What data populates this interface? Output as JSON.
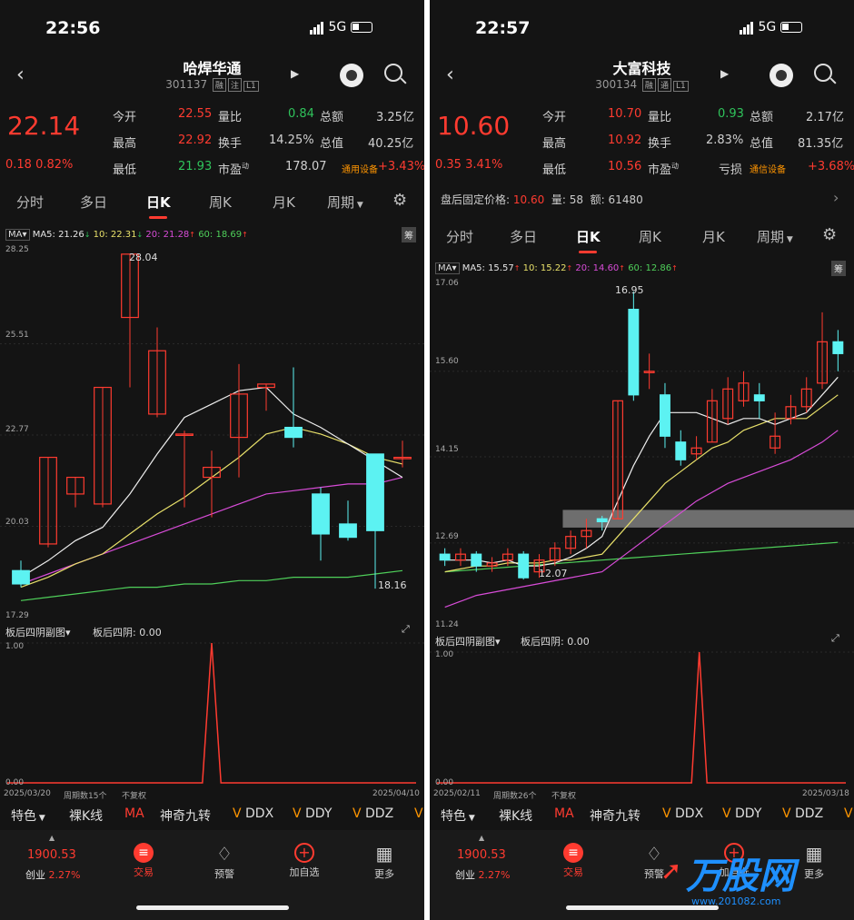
{
  "phones": [
    {
      "status": {
        "time": "22:56",
        "network": "5G"
      },
      "stock": {
        "name": "哈焊华通",
        "code": "301137",
        "tags": [
          "融",
          "注",
          "L1"
        ]
      },
      "quote": {
        "price": "22.14",
        "change": "0.18",
        "pct": "0.82%",
        "cells": [
          {
            "l": "今开",
            "v": "22.55"
          },
          {
            "l": "量比",
            "v": "0.84"
          },
          {
            "l": "总额",
            "v": "3.25亿"
          },
          {
            "l": "最高",
            "v": "22.92"
          },
          {
            "l": "换手",
            "v": "14.25%"
          },
          {
            "l": "总值",
            "v": "40.25亿"
          },
          {
            "l": "最低",
            "v": "21.93"
          },
          {
            "l": "市盈",
            "sup": "动",
            "v": "178.07"
          },
          {
            "l": "通用设备",
            "v": "+3.43%"
          }
        ]
      },
      "tabs": [
        "分时",
        "多日",
        "日K",
        "周K",
        "月K",
        "周期"
      ],
      "active_tab": "日K",
      "ma": {
        "box": "MA",
        "ma5": "MA5: 21.26",
        "ma10": "10: 22.31",
        "ma20": "20: 21.28",
        "ma60": "60: 18.69",
        "right": "筹"
      },
      "axis": {
        "top": "28.25",
        "a": "25.51",
        "b": "22.77",
        "c": "20.03",
        "bottom": "17.29"
      },
      "annot": {
        "high": "28.04",
        "low": "18.16"
      },
      "sub": {
        "title": "板后四阴副图",
        "value": "板后四阴: 0.00",
        "y_top": "1.00",
        "y_bottom": "0.00",
        "date_start": "2025/03/20",
        "period": "周期数15个",
        "adj": "不复权",
        "date_end": "2025/04/10"
      },
      "bottom_tabs": [
        "特色",
        "裸K线",
        "MA",
        "神奇九转",
        "DDX",
        "DDY",
        "DDZ"
      ],
      "nav": {
        "index_value": "1900.53",
        "index_name": "创业",
        "index_pct": "2.27%",
        "trade": "交易",
        "alert": "预警",
        "add": "加自选",
        "more": "更多"
      },
      "candles": [
        [
          18.7,
          18.3,
          19.0,
          18.2
        ],
        [
          19.5,
          22.1,
          22.1,
          19.4
        ],
        [
          21.0,
          21.5,
          21.5,
          20.6
        ],
        [
          20.7,
          24.2,
          24.2,
          20.6
        ],
        [
          26.3,
          28.2,
          28.2,
          24.2
        ],
        [
          23.4,
          25.3,
          26.0,
          23.3
        ],
        [
          22.8,
          22.8,
          22.9,
          20.6
        ],
        [
          21.5,
          21.8,
          22.3,
          20.3
        ],
        [
          22.7,
          24.0,
          24.9,
          21.5
        ],
        [
          24.2,
          24.3,
          24.3,
          23.5
        ],
        [
          23.0,
          22.7,
          24.8,
          22.4
        ],
        [
          21.0,
          19.8,
          21.2,
          19.0
        ],
        [
          20.1,
          19.7,
          20.8,
          19.6
        ],
        [
          22.2,
          19.9,
          22.2,
          18.16
        ],
        [
          22.1,
          22.1,
          22.6,
          21.8
        ]
      ],
      "ma_lines": {
        "ma5": [
          18.5,
          19.0,
          19.6,
          20.0,
          21.0,
          22.2,
          23.3,
          23.7,
          24.1,
          24.2,
          23.4,
          23.0,
          22.5,
          22.0,
          21.5
        ],
        "ma10": [
          18.2,
          18.5,
          18.9,
          19.2,
          19.8,
          20.4,
          20.9,
          21.5,
          22.1,
          22.8,
          23.0,
          22.8,
          22.5,
          22.1,
          21.9
        ],
        "ma20": [
          18.3,
          18.6,
          18.9,
          19.2,
          19.5,
          19.8,
          20.1,
          20.4,
          20.7,
          21.0,
          21.1,
          21.2,
          21.3,
          21.3,
          21.5
        ],
        "ma60": [
          17.8,
          17.9,
          18.0,
          18.1,
          18.2,
          18.2,
          18.3,
          18.3,
          18.4,
          18.4,
          18.5,
          18.5,
          18.5,
          18.6,
          18.7
        ]
      },
      "sub_series": [
        0,
        0,
        0,
        0,
        0,
        0,
        0,
        0,
        0,
        0,
        0,
        0,
        0,
        0,
        0,
        0,
        0,
        0,
        0,
        0,
        0,
        0,
        1,
        0,
        0,
        0,
        0,
        0,
        0,
        0,
        0,
        0,
        0,
        0,
        0,
        0,
        0,
        0,
        0,
        0,
        0,
        0,
        0,
        0,
        0
      ]
    },
    {
      "status": {
        "time": "22:57",
        "network": "5G"
      },
      "stock": {
        "name": "大富科技",
        "code": "300134",
        "tags": [
          "融",
          "通",
          "L1"
        ]
      },
      "quote": {
        "price": "10.60",
        "change": "0.35",
        "pct": "3.41%",
        "cells": [
          {
            "l": "今开",
            "v": "10.70"
          },
          {
            "l": "量比",
            "v": "0.93"
          },
          {
            "l": "总额",
            "v": "2.17亿"
          },
          {
            "l": "最高",
            "v": "10.92"
          },
          {
            "l": "换手",
            "v": "2.83%"
          },
          {
            "l": "总值",
            "v": "81.35亿"
          },
          {
            "l": "最低",
            "v": "10.56"
          },
          {
            "l": "市盈",
            "sup": "动",
            "v": "亏损"
          },
          {
            "l": "通信设备",
            "v": "+3.68%"
          }
        ]
      },
      "afterhours": {
        "label": "盘后固定价格:",
        "price": "10.60",
        "vol_label": "量:",
        "vol": "58",
        "amt_label": "额:",
        "amt": "61480"
      },
      "tabs": [
        "分时",
        "多日",
        "日K",
        "周K",
        "月K",
        "周期"
      ],
      "active_tab": "日K",
      "ma": {
        "box": "MA",
        "ma5": "MA5: 15.57",
        "ma10": "10: 15.22",
        "ma20": "20: 14.60",
        "ma60": "60: 12.86",
        "right": "筹"
      },
      "axis": {
        "top": "17.06",
        "a": "15.60",
        "b": "14.15",
        "c": "12.69",
        "bottom": "11.24"
      },
      "annot": {
        "high": "16.95",
        "low": "12.07"
      },
      "sub": {
        "title": "板后四阴副图",
        "value": "板后四阴: 0.00",
        "y_top": "1.00",
        "y_bottom": "0.00",
        "date_start": "2025/02/11",
        "period": "周期数26个",
        "adj": "不复权",
        "date_end": "2025/03/18"
      },
      "bottom_tabs": [
        "特色",
        "裸K线",
        "MA",
        "神奇九转",
        "DDX",
        "DDY",
        "DDZ"
      ],
      "nav": {
        "index_value": "1900.53",
        "index_name": "创业",
        "index_pct": "2.27%",
        "trade": "交易",
        "alert": "预警",
        "add": "加自选",
        "more": "更多"
      },
      "candles": [
        [
          12.5,
          12.4,
          12.6,
          12.3
        ],
        [
          12.4,
          12.5,
          12.6,
          12.3
        ],
        [
          12.5,
          12.3,
          12.55,
          12.2
        ],
        [
          12.3,
          12.35,
          12.45,
          12.2
        ],
        [
          12.4,
          12.5,
          12.6,
          12.3
        ],
        [
          12.5,
          12.1,
          12.55,
          12.07
        ],
        [
          12.2,
          12.4,
          12.5,
          12.1
        ],
        [
          12.4,
          12.6,
          12.7,
          12.3
        ],
        [
          12.6,
          12.8,
          12.9,
          12.5
        ],
        [
          12.8,
          12.9,
          13.1,
          12.6
        ],
        [
          13.1,
          13.05,
          13.15,
          12.9
        ],
        [
          13.1,
          15.1,
          15.1,
          13.1
        ],
        [
          16.65,
          15.2,
          16.95,
          15.1
        ],
        [
          15.6,
          15.6,
          15.9,
          15.3
        ],
        [
          15.2,
          14.5,
          15.4,
          14.3
        ],
        [
          14.4,
          14.1,
          14.6,
          14.0
        ],
        [
          14.2,
          14.3,
          14.5,
          14.1
        ],
        [
          14.4,
          15.1,
          15.3,
          14.4
        ],
        [
          14.8,
          15.3,
          15.5,
          14.7
        ],
        [
          15.1,
          15.4,
          15.6,
          15.0
        ],
        [
          15.2,
          15.1,
          15.4,
          14.8
        ],
        [
          14.3,
          14.5,
          14.9,
          14.2
        ],
        [
          14.8,
          15.0,
          15.2,
          14.7
        ],
        [
          15.0,
          15.3,
          15.5,
          14.9
        ],
        [
          15.4,
          16.1,
          16.6,
          15.3
        ],
        [
          16.1,
          15.9,
          16.3,
          15.6
        ]
      ],
      "ma_lines": {
        "ma5": [
          12.4,
          12.4,
          12.4,
          12.35,
          12.4,
          12.3,
          12.3,
          12.35,
          12.45,
          12.6,
          12.8,
          13.4,
          14.0,
          14.5,
          14.9,
          14.9,
          14.9,
          14.8,
          14.7,
          14.8,
          14.8,
          14.7,
          14.8,
          14.9,
          15.2,
          15.5
        ],
        "ma10": [
          12.2,
          12.25,
          12.3,
          12.3,
          12.35,
          12.35,
          12.35,
          12.4,
          12.4,
          12.45,
          12.5,
          12.8,
          13.1,
          13.4,
          13.7,
          13.9,
          14.1,
          14.3,
          14.4,
          14.6,
          14.7,
          14.8,
          14.8,
          14.8,
          15.0,
          15.2
        ],
        "ma20": [
          11.6,
          11.7,
          11.8,
          11.85,
          11.9,
          11.95,
          12.0,
          12.05,
          12.1,
          12.15,
          12.2,
          12.4,
          12.6,
          12.8,
          13.0,
          13.2,
          13.4,
          13.55,
          13.7,
          13.8,
          13.9,
          14.0,
          14.1,
          14.25,
          14.4,
          14.6
        ],
        "ma60": [
          12.2,
          12.22,
          12.24,
          12.26,
          12.28,
          12.3,
          12.32,
          12.34,
          12.36,
          12.38,
          12.4,
          12.42,
          12.44,
          12.46,
          12.48,
          12.5,
          12.52,
          12.54,
          12.56,
          12.58,
          12.6,
          12.62,
          12.64,
          12.66,
          12.68,
          12.7
        ]
      },
      "band": {
        "lo": 12.95,
        "hi": 13.25
      },
      "sub_series": [
        0,
        0,
        0,
        0,
        0,
        0,
        0,
        0,
        0,
        0,
        0,
        0,
        0,
        0,
        0,
        0,
        0,
        0,
        0,
        0,
        0,
        0,
        0,
        0,
        0,
        0,
        0,
        0,
        0,
        0,
        0,
        0,
        0,
        0,
        1,
        0,
        0,
        0,
        0,
        0,
        0,
        0,
        0,
        0,
        0,
        0,
        0,
        0,
        0,
        0,
        0,
        0,
        0,
        0
      ]
    }
  ],
  "watermark": {
    "brand": "万股网",
    "url": "www.201082.com"
  }
}
